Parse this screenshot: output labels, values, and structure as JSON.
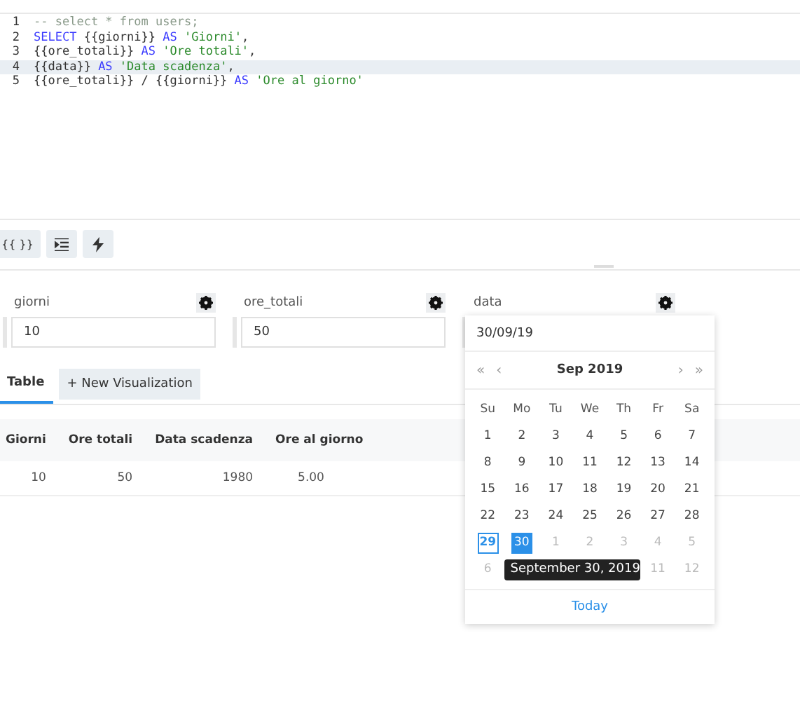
{
  "editor": {
    "lines": [
      {
        "number": "1",
        "highlighted": false,
        "tokens": [
          {
            "kind": "comment",
            "text": "-- select * from users;"
          }
        ]
      },
      {
        "number": "2",
        "highlighted": false,
        "tokens": [
          {
            "kind": "keyword",
            "text": "SELECT"
          },
          {
            "kind": "plain",
            "text": " {{giorni}} "
          },
          {
            "kind": "keyword",
            "text": "AS"
          },
          {
            "kind": "string",
            "text": " 'Giorni'"
          },
          {
            "kind": "plain",
            "text": ","
          }
        ]
      },
      {
        "number": "3",
        "highlighted": false,
        "tokens": [
          {
            "kind": "plain",
            "text": "{{ore_totali}} "
          },
          {
            "kind": "keyword",
            "text": "AS"
          },
          {
            "kind": "string",
            "text": " 'Ore totali'"
          },
          {
            "kind": "plain",
            "text": ","
          }
        ]
      },
      {
        "number": "4",
        "highlighted": true,
        "tokens": [
          {
            "kind": "plain",
            "text": "{{data}} "
          },
          {
            "kind": "keyword",
            "text": "AS"
          },
          {
            "kind": "string",
            "text": " 'Data scadenza'"
          },
          {
            "kind": "plain",
            "text": ","
          }
        ]
      },
      {
        "number": "5",
        "highlighted": false,
        "tokens": [
          {
            "kind": "plain",
            "text": "{{ore_totali}} / {{giorni}} "
          },
          {
            "kind": "keyword",
            "text": "AS"
          },
          {
            "kind": "string",
            "text": " 'Ore al giorno'"
          }
        ]
      }
    ]
  },
  "toolbar": [
    {
      "kind": "text",
      "label": "{{ }}"
    },
    {
      "kind": "indent"
    },
    {
      "kind": "bolt"
    }
  ],
  "parameters": [
    {
      "name": "giorni",
      "value": "10"
    },
    {
      "name": "ore_totali",
      "value": "50"
    },
    {
      "name": "data"
    }
  ],
  "tabs": [
    {
      "label": "Table",
      "selected": true
    }
  ],
  "new_visualization_button": "+ New Visualization",
  "table": {
    "columns": [
      "Giorni",
      "Ore totali",
      "Data scadenza",
      "Ore al giorno"
    ],
    "rows": [
      [
        "10",
        "50",
        "1980",
        "5.00"
      ]
    ]
  },
  "datepicker": {
    "value": "30/09/19",
    "nav": [
      "«",
      "‹",
      "›",
      "»"
    ],
    "month": "Sep 2019",
    "weekdays": [
      "Su",
      "Mo",
      "Tu",
      "We",
      "Th",
      "Fr",
      "Sa"
    ],
    "weeks": [
      {
        "days": [
          {
            "text": "1",
            "muted": false,
            "selected": false,
            "today": false
          },
          {
            "text": "2",
            "muted": false,
            "selected": false,
            "today": false
          },
          {
            "text": "3",
            "muted": false,
            "selected": false,
            "today": false
          },
          {
            "text": "4",
            "muted": false,
            "selected": false,
            "today": false
          },
          {
            "text": "5",
            "muted": false,
            "selected": false,
            "today": false
          },
          {
            "text": "6",
            "muted": false,
            "selected": false,
            "today": false
          },
          {
            "text": "7",
            "muted": false,
            "selected": false,
            "today": false
          }
        ]
      },
      {
        "days": [
          {
            "text": "8",
            "muted": false,
            "selected": false,
            "today": false
          },
          {
            "text": "9",
            "muted": false,
            "selected": false,
            "today": false
          },
          {
            "text": "10",
            "muted": false,
            "selected": false,
            "today": false
          },
          {
            "text": "11",
            "muted": false,
            "selected": false,
            "today": false
          },
          {
            "text": "12",
            "muted": false,
            "selected": false,
            "today": false
          },
          {
            "text": "13",
            "muted": false,
            "selected": false,
            "today": false
          },
          {
            "text": "14",
            "muted": false,
            "selected": false,
            "today": false
          }
        ]
      },
      {
        "days": [
          {
            "text": "15",
            "muted": false,
            "selected": false,
            "today": false
          },
          {
            "text": "16",
            "muted": false,
            "selected": false,
            "today": false
          },
          {
            "text": "17",
            "muted": false,
            "selected": false,
            "today": false
          },
          {
            "text": "18",
            "muted": false,
            "selected": false,
            "today": false
          },
          {
            "text": "19",
            "muted": false,
            "selected": false,
            "today": false
          },
          {
            "text": "20",
            "muted": false,
            "selected": false,
            "today": false
          },
          {
            "text": "21",
            "muted": false,
            "selected": false,
            "today": false
          }
        ]
      },
      {
        "days": [
          {
            "text": "22",
            "muted": false,
            "selected": false,
            "today": false
          },
          {
            "text": "23",
            "muted": false,
            "selected": false,
            "today": false
          },
          {
            "text": "24",
            "muted": false,
            "selected": false,
            "today": false
          },
          {
            "text": "25",
            "muted": false,
            "selected": false,
            "today": false
          },
          {
            "text": "26",
            "muted": false,
            "selected": false,
            "today": false
          },
          {
            "text": "27",
            "muted": false,
            "selected": false,
            "today": false
          },
          {
            "text": "28",
            "muted": false,
            "selected": false,
            "today": false
          }
        ]
      },
      {
        "days": [
          {
            "text": "29",
            "muted": false,
            "selected": false,
            "today": true
          },
          {
            "text": "30",
            "muted": false,
            "selected": true,
            "today": false
          },
          {
            "text": "1",
            "muted": true,
            "selected": false,
            "today": false
          },
          {
            "text": "2",
            "muted": true,
            "selected": false,
            "today": false
          },
          {
            "text": "3",
            "muted": true,
            "selected": false,
            "today": false
          },
          {
            "text": "4",
            "muted": true,
            "selected": false,
            "today": false
          },
          {
            "text": "5",
            "muted": true,
            "selected": false,
            "today": false
          }
        ]
      },
      {
        "tooltip": "September 30, 2019",
        "days": [
          {
            "text": "6",
            "muted": true,
            "selected": false,
            "today": false
          },
          {
            "text": "11",
            "muted": true,
            "selected": false,
            "today": false
          },
          {
            "text": "12",
            "muted": true,
            "selected": false,
            "today": false
          }
        ]
      }
    ],
    "footer": "Today"
  }
}
